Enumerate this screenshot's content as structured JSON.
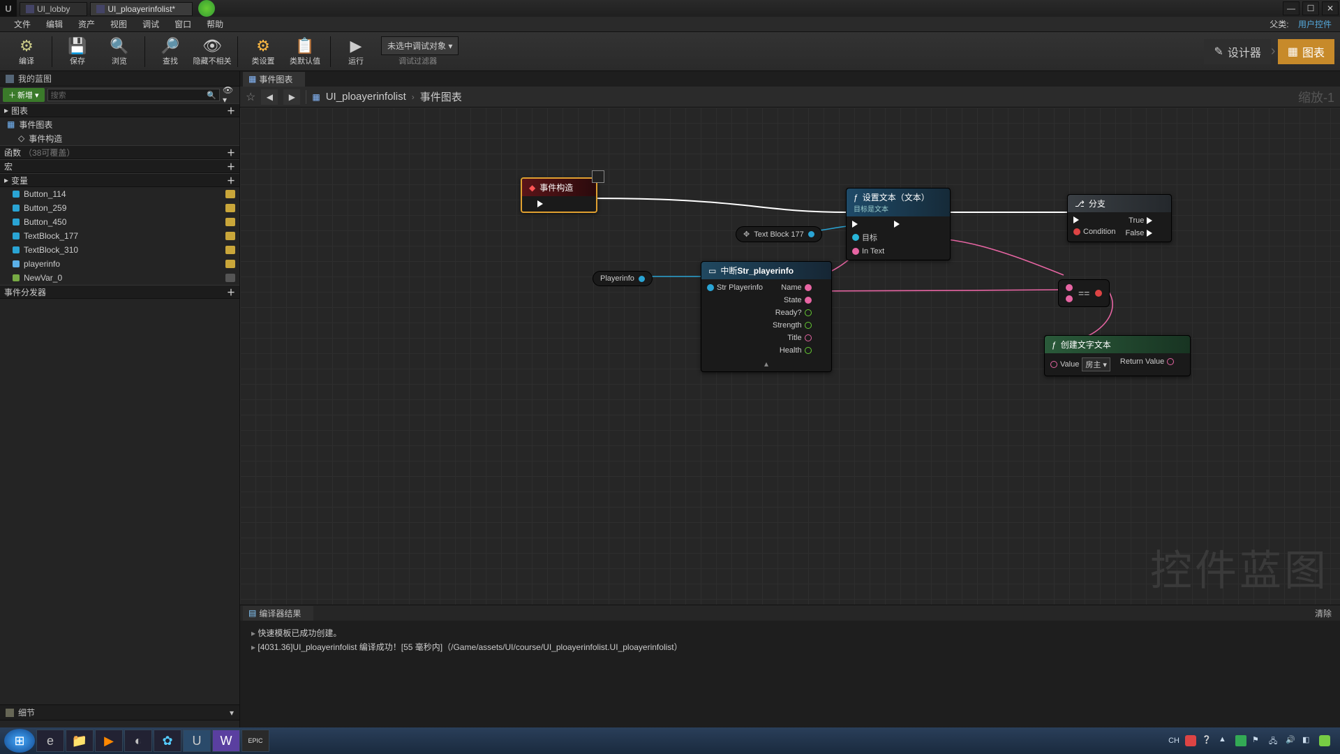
{
  "titlebar": {
    "tabs": [
      {
        "label": "UI_lobby",
        "active": false
      },
      {
        "label": "UI_ploayerinfolist*",
        "active": true
      }
    ]
  },
  "menu": {
    "items": [
      "文件",
      "编辑",
      "资产",
      "视图",
      "调试",
      "窗口",
      "帮助"
    ],
    "right_label": "父类:",
    "right_link": "用户控件"
  },
  "toolbar": {
    "compile": "编译",
    "save": "保存",
    "browse": "浏览",
    "find": "查找",
    "hide": "隐藏不相关",
    "class_settings": "类设置",
    "class_defaults": "类默认值",
    "play": "运行",
    "debug_dropdown": "未选中调试对象 ▾",
    "debug_filter": "调试过滤器",
    "mode_designer": "设计器",
    "mode_graph": "图表"
  },
  "leftpanel": {
    "title": "我的蓝图",
    "add": "新增 ▾",
    "search_ph": "搜索",
    "sec_graphs": "图表",
    "graph_item": "事件图表",
    "graph_sub": "事件构造",
    "sec_func": "函数",
    "func_hint": "（38可覆盖）",
    "sec_macro": "宏",
    "sec_var": "变量",
    "vars": [
      "Button_114",
      "Button_259",
      "Button_450",
      "TextBlock_177",
      "TextBlock_310",
      "playerinfo",
      "NewVar_0"
    ],
    "sec_dispatch": "事件分发器",
    "details": "细节"
  },
  "graph": {
    "tab": "事件图表",
    "crumb_bp": "UI_ploayerinfolist",
    "crumb_graph": "事件图表",
    "zoom": "缩放-1",
    "watermark": "控件蓝图",
    "node_event": "事件构造",
    "node_playerinfo": "Playerinfo",
    "node_textblock": "Text Block 177",
    "node_break_prefix": "中断",
    "node_break_name": "Str_playerinfo",
    "break_in": "Str Playerinfo",
    "break_outs": [
      "Name",
      "State",
      "Ready?",
      "Strength",
      "Title",
      "Health"
    ],
    "node_settext_title": "设置文本（文本）",
    "node_settext_sub": "目标是文本",
    "settext_pins": {
      "target": "目标",
      "intext": "In Text"
    },
    "node_branch": "分支",
    "branch_cond": "Condition",
    "branch_true": "True",
    "branch_false": "False",
    "node_eq": "==",
    "node_make": "创建文字文本",
    "make_value": "Value",
    "make_literal": "房主",
    "make_return": "Return Value"
  },
  "results": {
    "tab": "编译器结果",
    "line1": "快速模板已成功创建。",
    "line2": "[4031.36]UI_ploayerinfolist 编译成功！[55 毫秒内]（/Game/assets/UI/course/UI_ploayerinfolist.UI_ploayerinfolist）",
    "clear": "清除"
  },
  "taskbar": {
    "ime": "CH",
    "time": ""
  }
}
